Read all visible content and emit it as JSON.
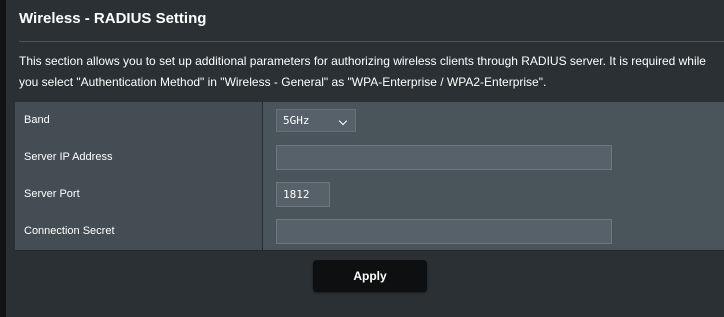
{
  "header": {
    "title": "Wireless - RADIUS Setting"
  },
  "description": {
    "line1": "This section allows you to set up additional parameters for authorizing wireless clients through RADIUS server. It is required while",
    "line2": "you select \"Authentication Method\" in \"Wireless - General\" as \"WPA-Enterprise / WPA2-Enterprise\"."
  },
  "form": {
    "band": {
      "label": "Band",
      "value": "5GHz"
    },
    "server_ip": {
      "label": "Server IP Address",
      "value": ""
    },
    "server_port": {
      "label": "Server Port",
      "value": "1812"
    },
    "connection_secret": {
      "label": "Connection Secret",
      "value": ""
    }
  },
  "actions": {
    "apply_label": "Apply"
  },
  "colors": {
    "background": "#2a3034",
    "label_cell": "#434d53",
    "value_cell": "#4a555b",
    "input": "#576169",
    "button": "#0d0f10"
  }
}
